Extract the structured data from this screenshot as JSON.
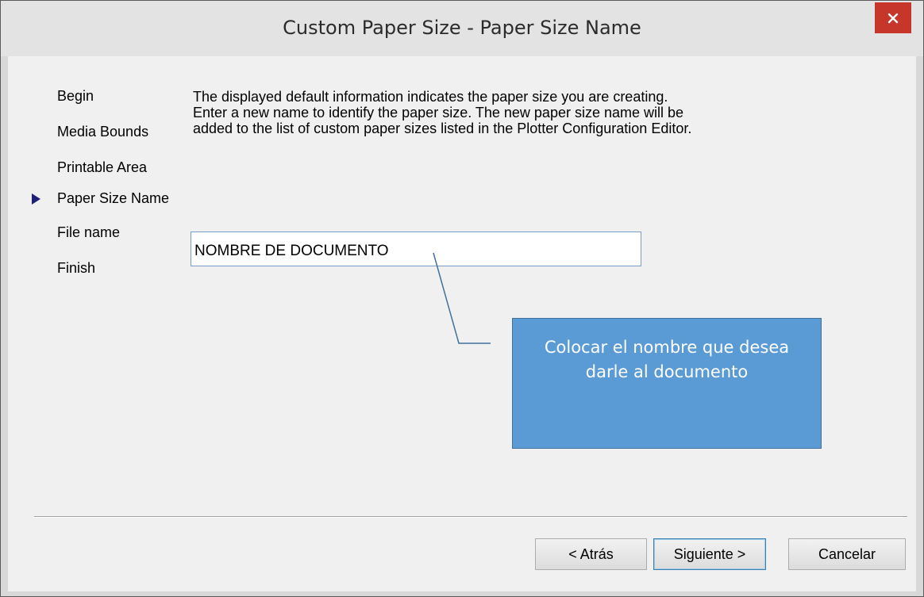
{
  "window": {
    "title": "Custom Paper Size - Paper Size Name",
    "close_symbol": "×"
  },
  "sidebar": {
    "items": [
      {
        "label": "Begin",
        "current": false
      },
      {
        "label": "Media Bounds",
        "current": false
      },
      {
        "label": "Printable Area",
        "current": false
      },
      {
        "label": "Paper Size Name",
        "current": true
      },
      {
        "label": "File name",
        "current": false
      },
      {
        "label": "Finish",
        "current": false
      }
    ],
    "current_marker_icon": "triangle-right-icon"
  },
  "main": {
    "description": "The displayed default information indicates the paper size you are creating. Enter a new name to identify the paper size. The new paper size name will be added to the list of custom paper sizes listed in the Plotter Configuration Editor.",
    "name_field": {
      "value": "NOMBRE DE DOCUMENTO"
    }
  },
  "callout": {
    "text": "Colocar el nombre que desea darle al documento",
    "fill_color": "#5a9bd5",
    "line_color": "#41719c"
  },
  "footer": {
    "back_label": "< Atrás",
    "next_label": "Siguiente >",
    "cancel_label": "Cancelar"
  },
  "colors": {
    "close_button": "#c7362b",
    "marker": "#1f1f7a"
  }
}
